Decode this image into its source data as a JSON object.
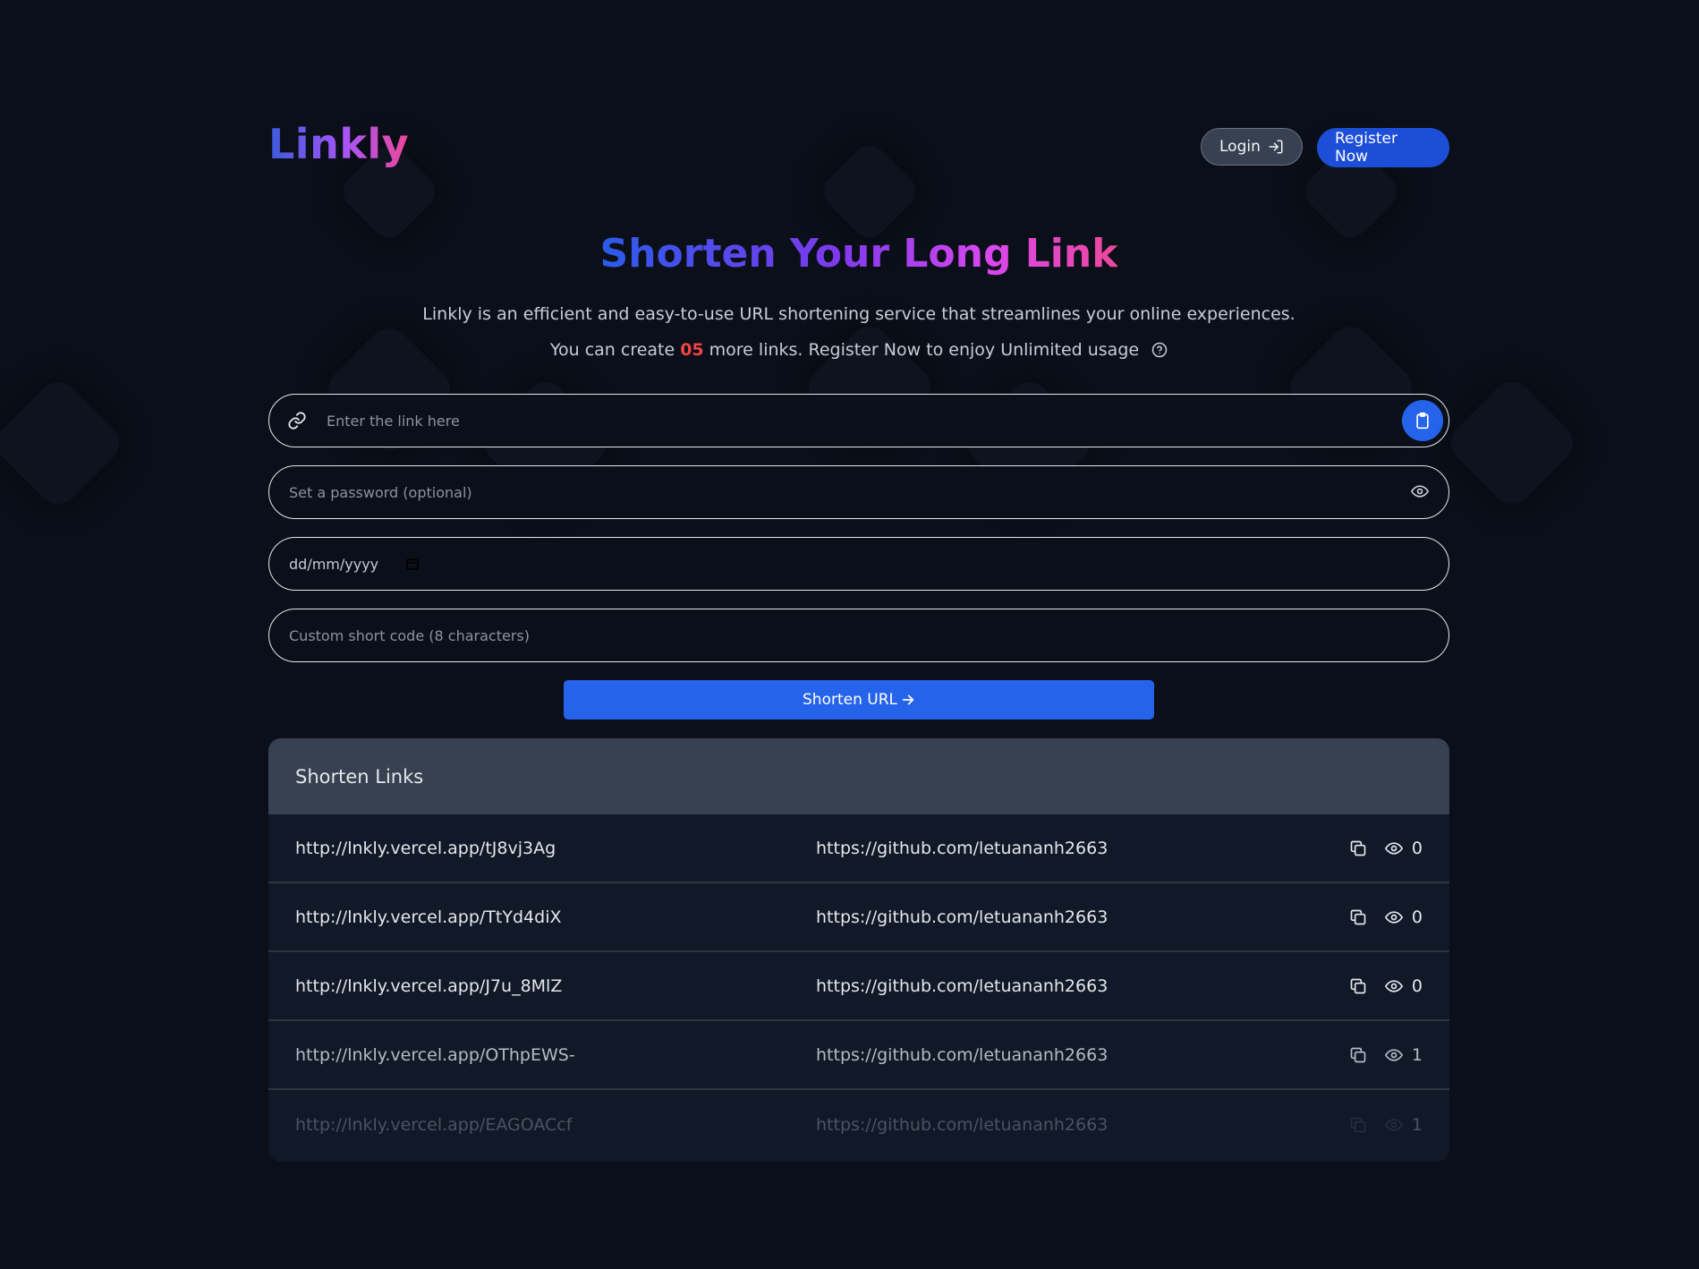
{
  "app": {
    "name": "Linkly"
  },
  "header": {
    "login_label": "Login",
    "register_label": "Register Now"
  },
  "hero": {
    "title": "Shorten Your Long Link",
    "description": "Linkly is an efficient and easy-to-use URL shortening service that streamlines your online experiences.",
    "limit_prefix": "You can create",
    "limit_count": "05",
    "limit_suffix": "more links. Register Now to enjoy Unlimited usage"
  },
  "form": {
    "link_placeholder": "Enter the link here",
    "password_placeholder": "Set a password (optional)",
    "date_value": "dd/mm/yyyy",
    "code_placeholder": "Custom short code (8 characters)",
    "submit_label": "Shorten URL"
  },
  "table": {
    "title": "Shorten Links",
    "rows": [
      {
        "short": "http://lnkly.vercel.app/tJ8vj3Ag",
        "original": "https://github.com/letuananh2663",
        "views": "0"
      },
      {
        "short": "http://lnkly.vercel.app/TtYd4diX",
        "original": "https://github.com/letuananh2663",
        "views": "0"
      },
      {
        "short": "http://lnkly.vercel.app/J7u_8MlZ",
        "original": "https://github.com/letuananh2663",
        "views": "0"
      },
      {
        "short": "http://lnkly.vercel.app/OThpEWS-",
        "original": "https://github.com/letuananh2663",
        "views": "1"
      },
      {
        "short": "http://lnkly.vercel.app/EAGOACcf",
        "original": "https://github.com/letuananh2663",
        "views": "1"
      }
    ]
  },
  "colors": {
    "background": "#0b0f19",
    "primary": "#2563eb",
    "limit_count": "#ef4444",
    "table_header": "#374151"
  },
  "icons": {
    "login": "login-arrow-icon",
    "link": "link-icon",
    "paste": "clipboard-icon",
    "password_toggle": "eye-icon",
    "date": "calendar-icon",
    "help": "question-circle-icon",
    "copy": "copy-icon",
    "views": "eye-icon",
    "submit": "arrow-right-icon"
  }
}
